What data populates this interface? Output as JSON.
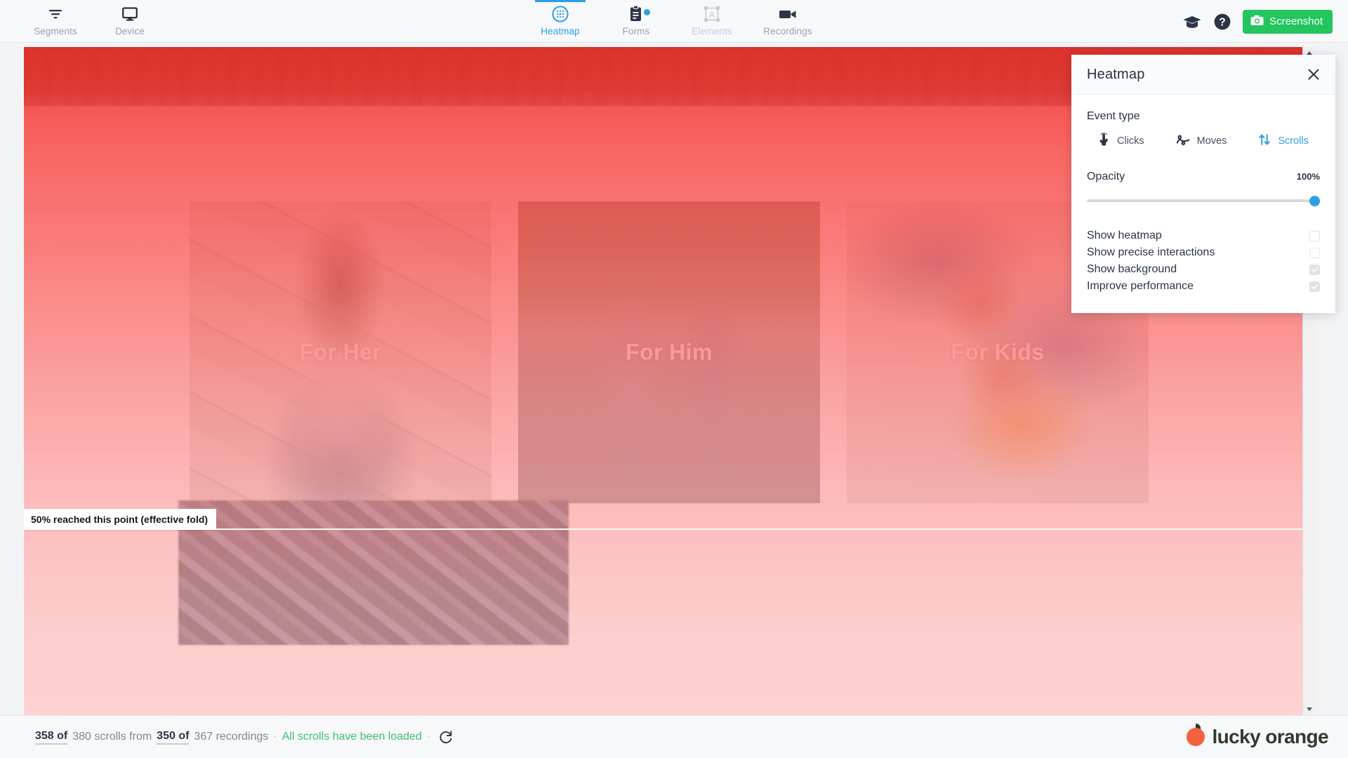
{
  "topbar": {
    "left_items": [
      {
        "label": "Segments",
        "icon": "filter-icon"
      },
      {
        "label": "Device",
        "icon": "monitor-icon"
      }
    ],
    "center_tabs": [
      {
        "label": "Heatmap",
        "icon": "heatmap-icon",
        "active": true,
        "disabled": false,
        "badge": false
      },
      {
        "label": "Forms",
        "icon": "clipboard-icon",
        "active": false,
        "disabled": false,
        "badge": true
      },
      {
        "label": "Elements",
        "icon": "element-box-icon",
        "active": false,
        "disabled": true,
        "badge": false
      },
      {
        "label": "Recordings",
        "icon": "video-camera-icon",
        "active": false,
        "disabled": false,
        "badge": false
      }
    ],
    "right": {
      "graduation_icon": "graduation-cap-icon",
      "help_icon": "question-circle-icon",
      "screenshot_label": "Screenshot",
      "screenshot_icon": "camera-icon",
      "screenshot_color": "#22c55e"
    }
  },
  "panel": {
    "title": "Heatmap",
    "close_icon": "close-icon",
    "event_type_label": "Event type",
    "event_types": [
      {
        "label": "Clicks",
        "icon": "pointer-finger-icon",
        "active": false
      },
      {
        "label": "Moves",
        "icon": "squiggle-icon",
        "active": false
      },
      {
        "label": "Scrolls",
        "icon": "up-down-arrows-icon",
        "active": true
      }
    ],
    "opacity_label": "Opacity",
    "opacity_value": "100%",
    "opacity_percent": 100,
    "accent_color": "#2e9fe3",
    "options": [
      {
        "label": "Show heatmap",
        "checked": false,
        "disabled": false
      },
      {
        "label": "Show precise interactions",
        "checked": false,
        "disabled": false
      },
      {
        "label": "Show background",
        "checked": true,
        "disabled": true
      },
      {
        "label": "Improve performance",
        "checked": true,
        "disabled": true
      }
    ]
  },
  "page": {
    "cards": [
      {
        "label": "For Her",
        "image": "woman-in-denim-against-newspaper-wall"
      },
      {
        "label": "For Him",
        "image": "two-men-in-denim-jackets-on-street"
      },
      {
        "label": "For Kids",
        "image": "children-in-denim-jackets-lying-down"
      }
    ],
    "hero_image": "clothing-rack-banner",
    "lower_image": "denim-fabric-closeup"
  },
  "heatmap": {
    "fold_tooltip": "50% reached this point (effective fold)",
    "fold_percent": 50,
    "hot_color": "#e22c26",
    "cool_color": "#fcb6b5"
  },
  "footer": {
    "scrolls_counted": "358 of",
    "scrolls_total": "380 scrolls from",
    "recordings_counted": "350 of",
    "recordings_total": "367 recordings",
    "separator": "·",
    "loaded_message": "All scrolls have been loaded",
    "refresh_icon": "refresh-icon",
    "brand_name": "lucky orange",
    "brand_icon": "orange-fruit-icon"
  },
  "scrollbar": {
    "up_icon": "scroll-up-arrow-icon",
    "down_icon": "scroll-down-arrow-icon"
  }
}
